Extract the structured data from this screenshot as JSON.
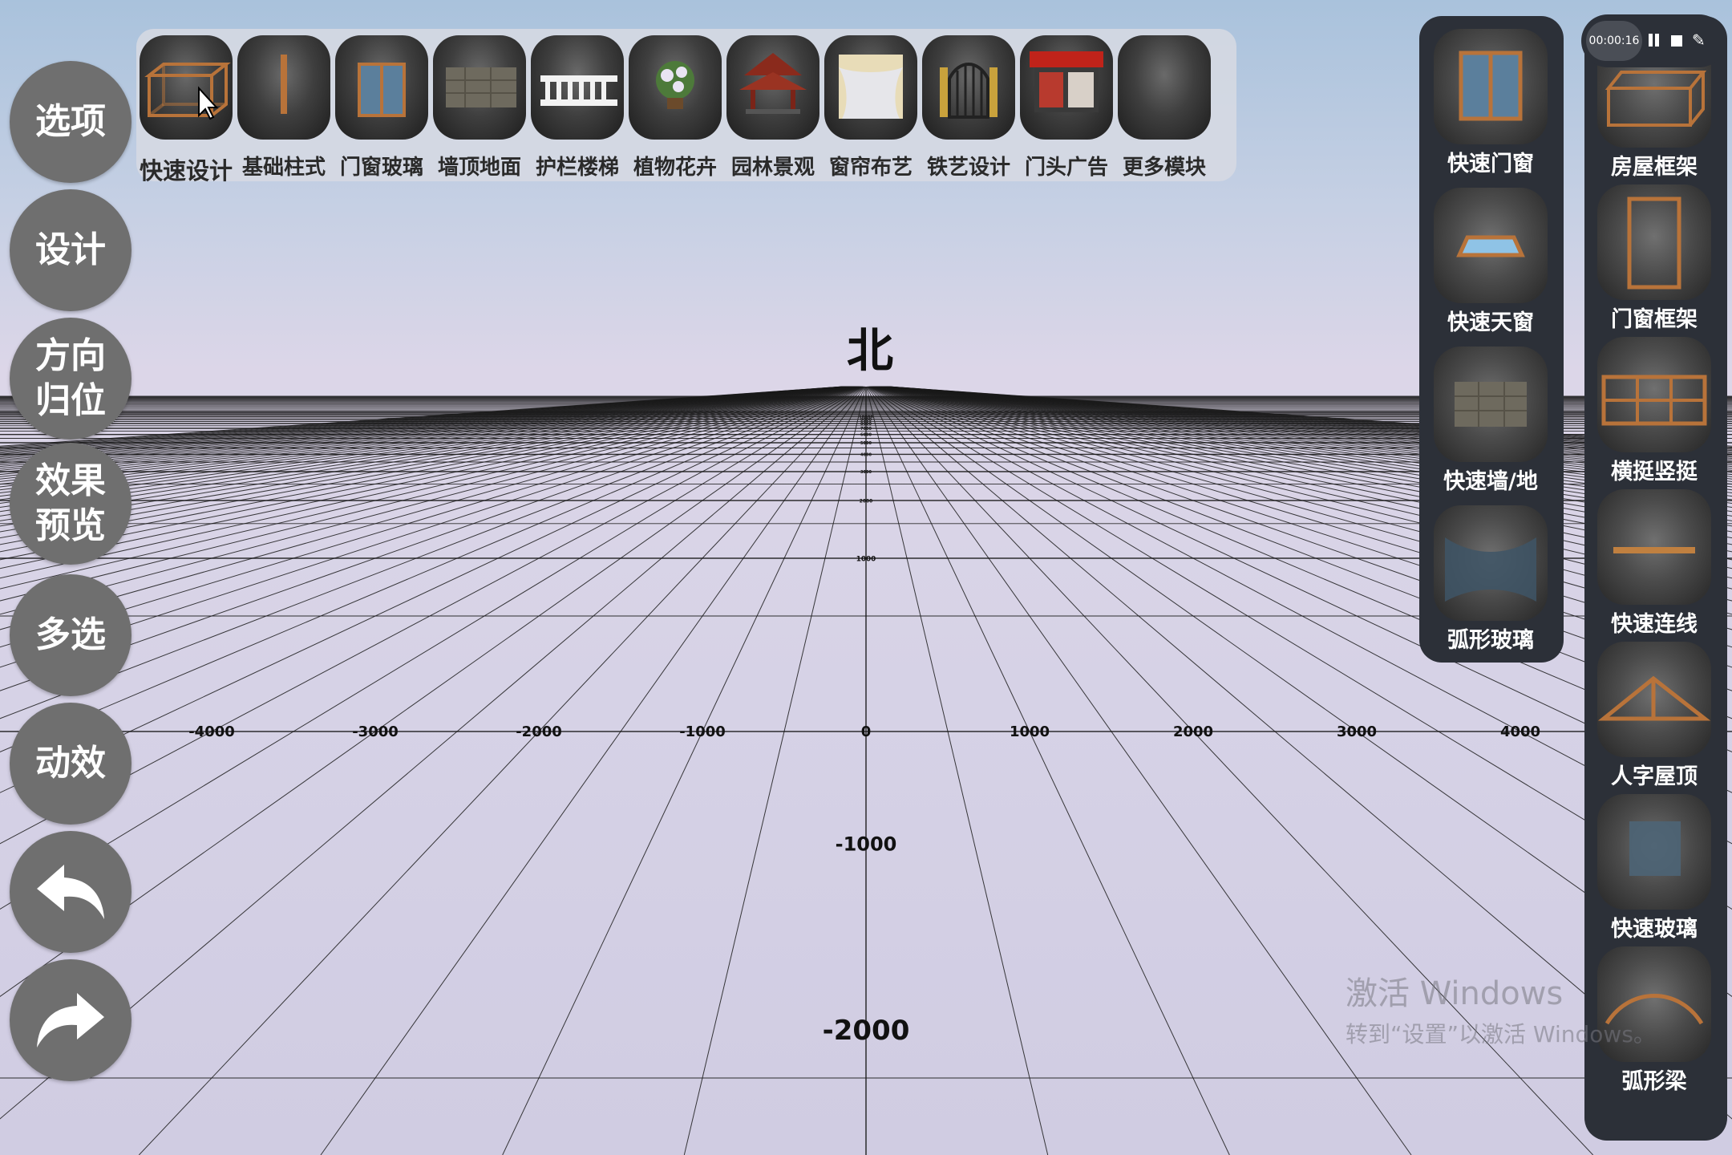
{
  "left_buttons": [
    {
      "label": "选项"
    },
    {
      "label": "设计"
    },
    {
      "label": "方向\n归位"
    },
    {
      "label": "效果\n预览"
    },
    {
      "label": "多选"
    },
    {
      "label": "动效"
    },
    {
      "label": "",
      "icon": "undo-arrow-icon"
    },
    {
      "label": "",
      "icon": "redo-arrow-icon"
    }
  ],
  "top_toolbar": {
    "items": [
      {
        "label": "快速设计",
        "icon": "frame-box-icon",
        "active": true
      },
      {
        "label": "基础柱式",
        "icon": "column-icon"
      },
      {
        "label": "门窗玻璃",
        "icon": "window-icon"
      },
      {
        "label": "墙顶地面",
        "icon": "stone-wall-icon"
      },
      {
        "label": "护栏楼梯",
        "icon": "balustrade-icon"
      },
      {
        "label": "植物花卉",
        "icon": "plant-icon"
      },
      {
        "label": "园林景观",
        "icon": "pavilion-icon"
      },
      {
        "label": "窗帘布艺",
        "icon": "curtain-icon"
      },
      {
        "label": "铁艺设计",
        "icon": "iron-gate-icon"
      },
      {
        "label": "门头广告",
        "icon": "storefront-icon"
      },
      {
        "label": "更多模块",
        "icon": "more-modules-icon"
      }
    ]
  },
  "right_panel_1": {
    "items": [
      {
        "label": "快速门窗",
        "icon": "door-window-icon"
      },
      {
        "label": "快速天窗",
        "icon": "skylight-icon"
      },
      {
        "label": "快速墙/地",
        "icon": "wall-floor-icon"
      },
      {
        "label": "弧形玻璃",
        "icon": "curved-glass-icon"
      }
    ]
  },
  "right_panel_2": {
    "items": [
      {
        "label": "房屋框架",
        "icon": "house-frame-icon"
      },
      {
        "label": "门窗框架",
        "icon": "door-frame-icon"
      },
      {
        "label": "横挺竖挺",
        "icon": "mullion-icon"
      },
      {
        "label": "快速连线",
        "icon": "beam-line-icon"
      },
      {
        "label": "人字屋顶",
        "icon": "gable-roof-icon"
      },
      {
        "label": "快速玻璃",
        "icon": "glass-pane-icon"
      },
      {
        "label": "弧形梁",
        "icon": "arched-beam-icon"
      }
    ]
  },
  "recorder": {
    "time": "00:00:16"
  },
  "scene": {
    "north_label": "北",
    "x_axis_ticks": [
      "-4000",
      "-3000",
      "-2000",
      "-1000",
      "0",
      "1000",
      "2000",
      "3000",
      "4000"
    ],
    "depth_ticks": [
      "1000",
      "2000",
      "3000",
      "4000",
      "5000",
      "6000",
      "7000",
      "8000",
      "9000",
      "10000"
    ],
    "near_ticks": [
      "-1000",
      "-2000"
    ]
  },
  "watermark": {
    "line1": "激活 Windows",
    "line2": "转到“设置”以激活 Windows。"
  }
}
